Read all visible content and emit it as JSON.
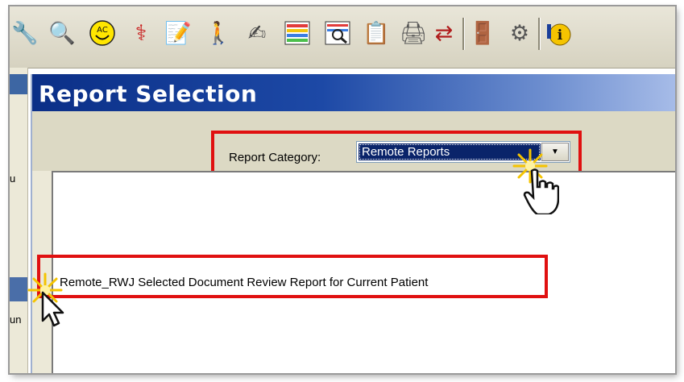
{
  "toolbar": {
    "icons": [
      "wrench-icon",
      "magnifier-icon",
      "ac-smiley-icon",
      "caduceus-icon",
      "notepad-pen-icon",
      "person-icon",
      "checklist-icon",
      "report-grid-icon",
      "search-document-icon",
      "clipboard-icon",
      "printer-icon",
      "users-transfer-icon",
      "exit-door-icon",
      "tools-icon",
      "info-icon"
    ]
  },
  "left_strip": {
    "text_top": "u",
    "text_bottom": "un"
  },
  "dialog": {
    "title": "Report Selection",
    "category_label": "Report Category:",
    "category_value": "Remote Reports",
    "dropdown_arrow": "▼",
    "reports": [
      {
        "label": "Remote_RWJ Selected Document Review Report for Current Patient"
      }
    ]
  },
  "annotations": {
    "highlight_color": "#e01010",
    "sparkle_color": "#f5c400"
  }
}
